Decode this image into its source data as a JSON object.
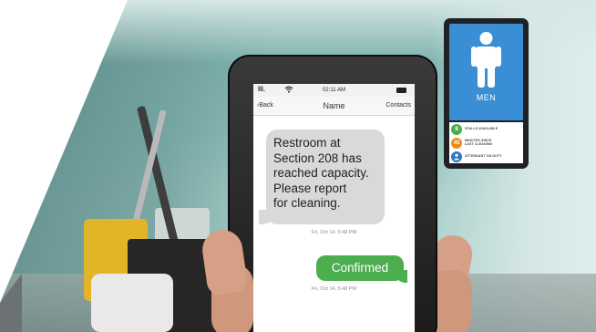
{
  "colors": {
    "sign_blue": "#3a8fd4",
    "badge_green": "#4cae4f",
    "badge_orange": "#f08c1e",
    "badge_blue": "#2f78c4",
    "outgoing_bubble": "#4cae4f",
    "incoming_bubble": "#d9d9d9"
  },
  "sign": {
    "icon": "man-icon",
    "title": "MEN",
    "rows": [
      {
        "badge": "8",
        "text": "STALLS AVAILABLE"
      },
      {
        "badge": "45",
        "text": "MINUTES SINCE\nLAST CLEANING"
      },
      {
        "badge": "",
        "icon": "person-icon",
        "text": "ATTENDANT ON DUTY"
      }
    ]
  },
  "phone": {
    "status": {
      "time": "02:11 AM",
      "signal": "lll.",
      "wifi_icon": "wifi-icon",
      "battery_icon": "battery-icon"
    },
    "nav": {
      "back": "‹Back",
      "title": "Name",
      "contacts": "Contacts"
    },
    "messages": [
      {
        "direction": "incoming",
        "text": "Restroom at\nSection 208 has\nreached capacity.\nPlease report\nfor cleaning.",
        "timestamp": "Fri, Oct 14, 5:48 PM"
      },
      {
        "direction": "outgoing",
        "text": "Confirmed",
        "timestamp": "Fri, Oct 14, 5:48 PM"
      }
    ]
  }
}
